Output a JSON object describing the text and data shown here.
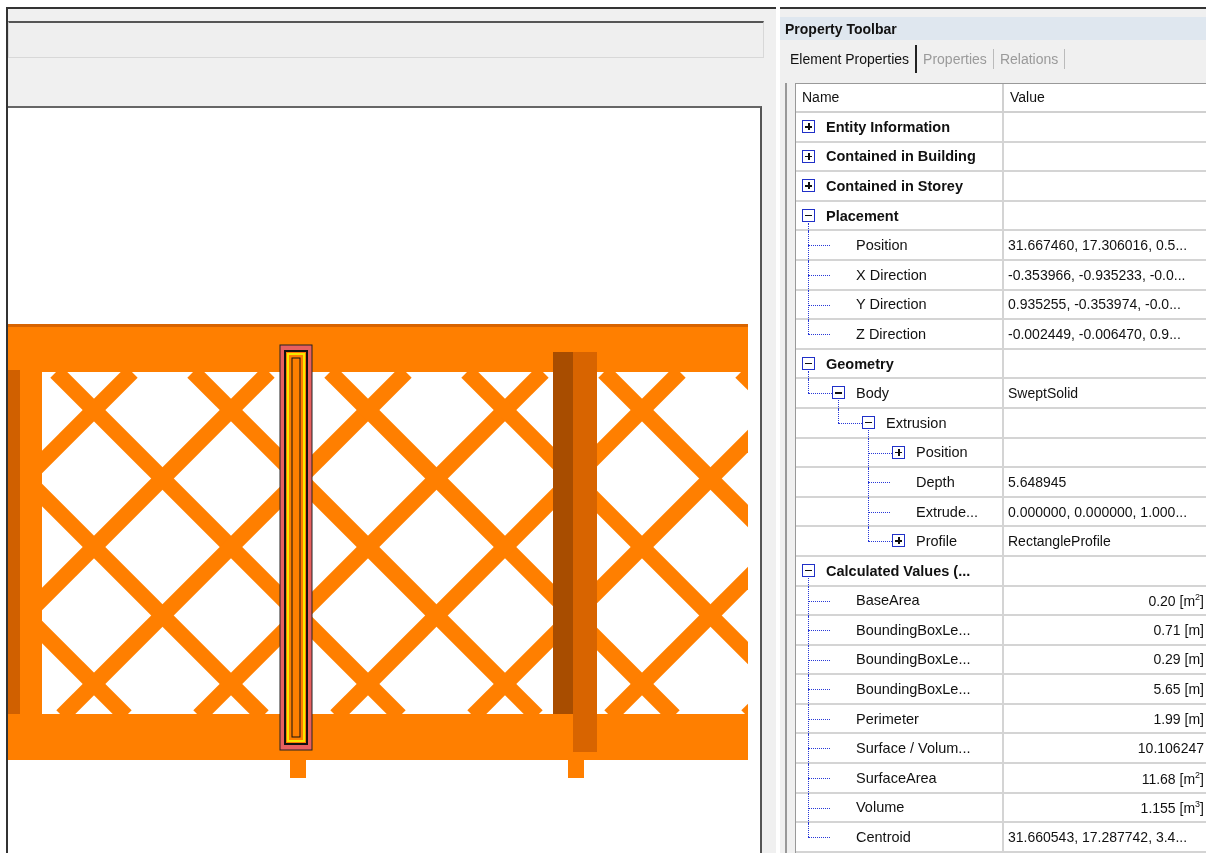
{
  "property_panel": {
    "title": "Property Toolbar",
    "tabs": [
      {
        "label": "Element Properties",
        "selected": true
      },
      {
        "label": "Properties",
        "selected": false
      },
      {
        "label": "Relations",
        "selected": false
      }
    ],
    "table": {
      "columns": [
        "Name",
        "Value"
      ],
      "rows": [
        {
          "name": "Entity Information",
          "expanded": false
        },
        {
          "name": "Contained in Building",
          "expanded": false
        },
        {
          "name": "Contained in Storey",
          "expanded": false
        },
        {
          "name": "Placement",
          "expanded": true,
          "children": [
            {
              "name": "Position",
              "value": "31.667460, 17.306016, 0.5...",
              "kind": "text"
            },
            {
              "name": "X Direction",
              "value": "-0.353966, -0.935233, -0.0...",
              "kind": "text"
            },
            {
              "name": "Y Direction",
              "value": "0.935255, -0.353974, -0.0...",
              "kind": "text"
            },
            {
              "name": "Z Direction",
              "value": "-0.002449, -0.006470, 0.9...",
              "kind": "text"
            }
          ]
        },
        {
          "name": "Geometry",
          "expanded": true,
          "children": [
            {
              "name": "Body",
              "value": "SweptSolid",
              "kind": "text",
              "expanded": true,
              "children": [
                {
                  "name": "Extrusion",
                  "expanded": true,
                  "children": [
                    {
                      "name": "Position",
                      "expanded": false
                    },
                    {
                      "name": "Depth",
                      "value": "5.648945",
                      "kind": "text"
                    },
                    {
                      "name": "Extrude...",
                      "value": "0.000000, 0.000000, 1.000...",
                      "kind": "text"
                    },
                    {
                      "name": "Profile",
                      "value": "RectangleProfile",
                      "kind": "text",
                      "expanded": false
                    }
                  ]
                }
              ]
            }
          ]
        },
        {
          "name": "Calculated Values (...",
          "expanded": true,
          "children": [
            {
              "name": "BaseArea",
              "value": "0.20 [m$^{2}$]",
              "kind": "quantity"
            },
            {
              "name": "BoundingBoxLe...",
              "value": "0.71 [m]",
              "kind": "quantity"
            },
            {
              "name": "BoundingBoxLe...",
              "value": "0.29 [m]",
              "kind": "quantity"
            },
            {
              "name": "BoundingBoxLe...",
              "value": "5.65 [m]",
              "kind": "quantity"
            },
            {
              "name": "Perimeter",
              "value": "1.99 [m]",
              "kind": "quantity"
            },
            {
              "name": "Surface / Volum...",
              "value": "10.106247",
              "kind": "quantity"
            },
            {
              "name": "SurfaceArea",
              "value": "11.68 [m$^{2}$]",
              "kind": "quantity"
            },
            {
              "name": "Volume",
              "value": "1.155 [m$^{3}$]",
              "kind": "quantity"
            },
            {
              "name": "Centroid",
              "value": "31.660543, 17.287742, 3.4...",
              "kind": "text"
            }
          ]
        }
      ]
    }
  }
}
